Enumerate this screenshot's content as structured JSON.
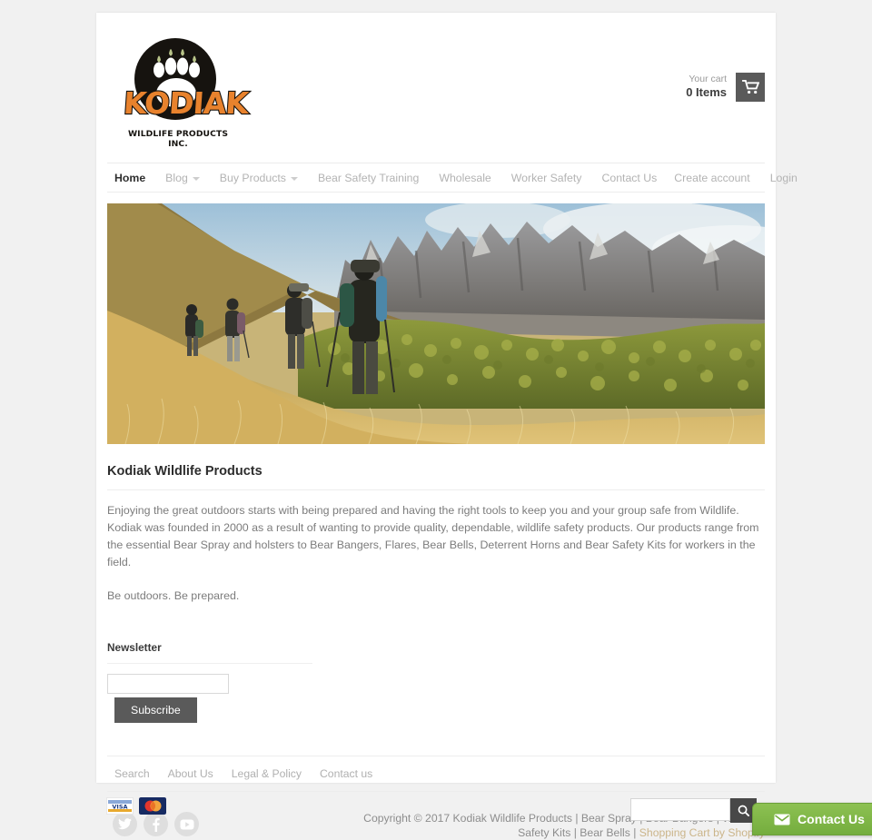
{
  "brand": {
    "logo_name": "KODIAK",
    "logo_tagline": "WILDLIFE PRODUCTS INC.",
    "logo_icon": "bear-paw-icon",
    "orange": "#e8822d",
    "dark": "#16130f"
  },
  "cart": {
    "label": "Your cart",
    "count_text": "0 Items",
    "icon": "shopping-cart-icon"
  },
  "nav": {
    "left": [
      {
        "label": "Home",
        "active": true,
        "caret": false
      },
      {
        "label": "Blog",
        "active": false,
        "caret": true
      },
      {
        "label": "Buy Products",
        "active": false,
        "caret": true
      },
      {
        "label": "Bear Safety Training",
        "active": false,
        "caret": false
      },
      {
        "label": "Wholesale",
        "active": false,
        "caret": false
      },
      {
        "label": "Worker Safety",
        "active": false,
        "caret": false
      },
      {
        "label": "Contact Us",
        "active": false,
        "caret": false
      }
    ],
    "right": [
      {
        "label": "Create account"
      },
      {
        "label": "Login"
      }
    ]
  },
  "hero": {
    "alt": "Hikers with backpacks walking up a golden grassy mountain slope with rocky cliffs and forest behind"
  },
  "main": {
    "heading": "Kodiak Wildlife Products",
    "paragraph1": "Enjoying the great outdoors starts with being prepared and having the right tools to keep you and your group safe from Wildlife. Kodiak was founded in 2000 as a result of wanting to provide quality, dependable, wildlife safety products.  Our products range from the essential Bear Spray and holsters to Bear Bangers, Flares, Bear Bells, Deterrent Horns and Bear Safety Kits for workers in the field.",
    "paragraph2": "Be outdoors.  Be prepared."
  },
  "newsletter": {
    "heading": "Newsletter",
    "input_value": "",
    "input_placeholder": "",
    "button_label": "Subscribe"
  },
  "footer": {
    "links": [
      "Search",
      "About Us",
      "Legal & Policy",
      "Contact us"
    ],
    "social": [
      {
        "name": "twitter-icon"
      },
      {
        "name": "facebook-icon"
      },
      {
        "name": "youtube-icon"
      }
    ],
    "copyright_text": "Copyright © 2017 Kodiak Wildlife Products | Bear Spray | Bear Bangers | Wild Life Safety Kits | Bear Bells | ",
    "shopify_link": "Shopping Cart by Shopify",
    "shopify_color": "#cbb58a"
  },
  "payments": [
    {
      "name": "visa-icon",
      "label": "VISA"
    },
    {
      "name": "mastercard-icon",
      "label": "Mastercard"
    }
  ],
  "search": {
    "value": "",
    "placeholder": "",
    "button_icon": "search-icon"
  },
  "contact_widget": {
    "label": "Contact Us",
    "icon": "envelope-icon",
    "color": "#7ab84e"
  }
}
